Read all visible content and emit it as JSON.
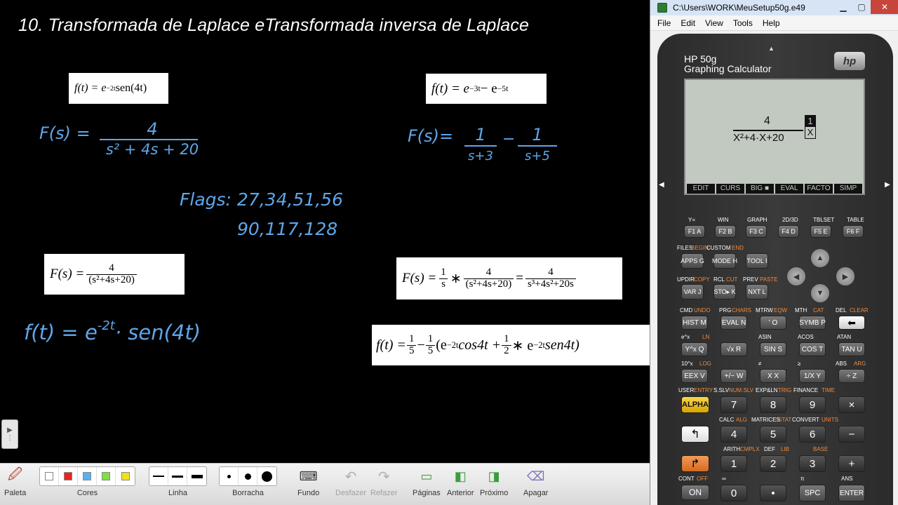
{
  "board": {
    "title": "10. Transformada de Laplace eTransformada inversa de Laplace",
    "box1": {
      "lhs": "f(t) = e",
      "exp": "−2t",
      "rhs": "sen(4t)"
    },
    "box2": {
      "lhs": "f(t) = e",
      "exp1": "−3t",
      "mid": " −  e",
      "exp2": "−5t"
    },
    "box3": {
      "lhs": "F(s) = ",
      "num": "4",
      "den": "(s²+4s+20)"
    },
    "box4": {
      "lhs": "F(s) = ",
      "n1": "1",
      "d1": "s",
      "op": " ∗ ",
      "n2": "4",
      "d2": "(s²+4s+20)",
      "eq": " = ",
      "n3": "4",
      "d3": "s³+4s²+20s"
    },
    "box5": {
      "lhs": "f(t) = ",
      "a_n": "1",
      "a_d": "5",
      "minus": "−",
      "b_n": "1",
      "b_d": "5",
      "p1": " (e",
      "e1": "−2t",
      "t1": "cos4t + ",
      "c_n": "1",
      "c_d": "2",
      "star": " ∗ e",
      "e2": "−2t",
      "t2": "sen4t)"
    },
    "hand1": {
      "lhs": "F(s) =",
      "num": "4",
      "den": "s² + 4s + 20"
    },
    "hand2": {
      "lhs": "F(s)=",
      "n1": "1",
      "d1": "s+3",
      "op": "−",
      "n2": "1",
      "d2": "s+5"
    },
    "hand3": {
      "line1": "Flags: 27,34,51,56",
      "line2": "90,117,128"
    },
    "hand4": {
      "text": "f(t) = e",
      "exp": "-2t",
      "rest": "· sen(4t)"
    }
  },
  "toolbar": {
    "paleta": "Paleta",
    "cores": "Cores",
    "linha": "Linha",
    "borracha": "Borracha",
    "fundo": "Fundo",
    "desfazer": "Desfazer",
    "refazer": "Refazer",
    "paginas": "Páginas",
    "anterior": "Anterior",
    "proximo": "Próximo",
    "apagar": "Apagar",
    "colors": [
      "#ffffff",
      "#e8241c",
      "#5ab0f0",
      "#7ee040",
      "#f0e020"
    ]
  },
  "emulator": {
    "window_title": "C:\\Users\\WORK\\MeuSetup50g.e49",
    "menu": [
      "File",
      "Edit",
      "View",
      "Tools",
      "Help"
    ],
    "brand1": "HP 50g",
    "brand2": "Graphing Calculator",
    "logo": "hp",
    "lcd": {
      "num": "4",
      "den": "X²+4·X+20",
      "side1": "1",
      "side2": "X"
    },
    "softkeys": [
      "EDIT",
      "CURS",
      "BIG ■",
      "EVAL",
      "FACTO",
      "SIMP"
    ],
    "fn_labels": [
      "Y=",
      "WIN",
      "GRAPH",
      "2D/3D",
      "TBLSET",
      "TABLE"
    ],
    "fn_keys": [
      "F1 A",
      "F2 B",
      "F3 C",
      "F4 D",
      "F5 E",
      "F6 F"
    ],
    "row2_labels": [
      "FILES",
      "BEGIN",
      "CUSTOM",
      "END"
    ],
    "row2_keys": [
      "APPS G",
      "MODE H",
      "TOOL I"
    ],
    "row3_labels": [
      "UPDIR",
      "COPY",
      "RCL",
      "CUT",
      "PREV",
      "PASTE"
    ],
    "row3_keys": [
      "VAR J",
      "STO▸ K",
      "NXT L"
    ],
    "row4_labels": [
      "CMD",
      "UNDO",
      "PRG",
      "CHARS",
      "MTRW",
      "EQW",
      "MTH",
      "CAT",
      "DEL",
      "CLEAR"
    ],
    "row4_keys": [
      "HIST M",
      "EVAL N",
      "' O",
      "SYMB P",
      "⬅"
    ],
    "row5_labels": [
      "e^x",
      "LN",
      "ASIN",
      "ACOS",
      "ATAN"
    ],
    "row5_keys": [
      "Y^x Q",
      "√x R",
      "SIN S",
      "COS T",
      "TAN U"
    ],
    "row6_labels": [
      "10^x",
      "LOG",
      "≠",
      "≥",
      "ABS",
      "ARG"
    ],
    "row6_keys": [
      "EEX V",
      "+/− W",
      "X X",
      "1/X Y",
      "÷ Z"
    ],
    "row7_labels": [
      "USER",
      "ENTRY",
      "S.SLV",
      "NUM.SLV",
      "EXP&LN",
      "TRIG",
      "FINANCE",
      "TIME"
    ],
    "row7_keys": [
      "ALPHA",
      "7",
      "8",
      "9",
      "×"
    ],
    "row8_labels": [
      "CALC",
      "ALG",
      "MATRICES",
      "STAT",
      "CONVERT",
      "UNITS"
    ],
    "row8_keys": [
      "↰",
      "4",
      "5",
      "6",
      "−"
    ],
    "row9_labels": [
      "ARITH",
      "CMPLX",
      "DEF",
      "LIB",
      "BASE"
    ],
    "row9_keys": [
      "↱",
      "1",
      "2",
      "3",
      "+"
    ],
    "row10_labels": [
      "CONT",
      "OFF",
      "∞",
      "π",
      "ANS",
      "ENTER"
    ],
    "row10_keys": [
      "ON",
      "0",
      "•",
      "SPC",
      "ENTER"
    ]
  }
}
